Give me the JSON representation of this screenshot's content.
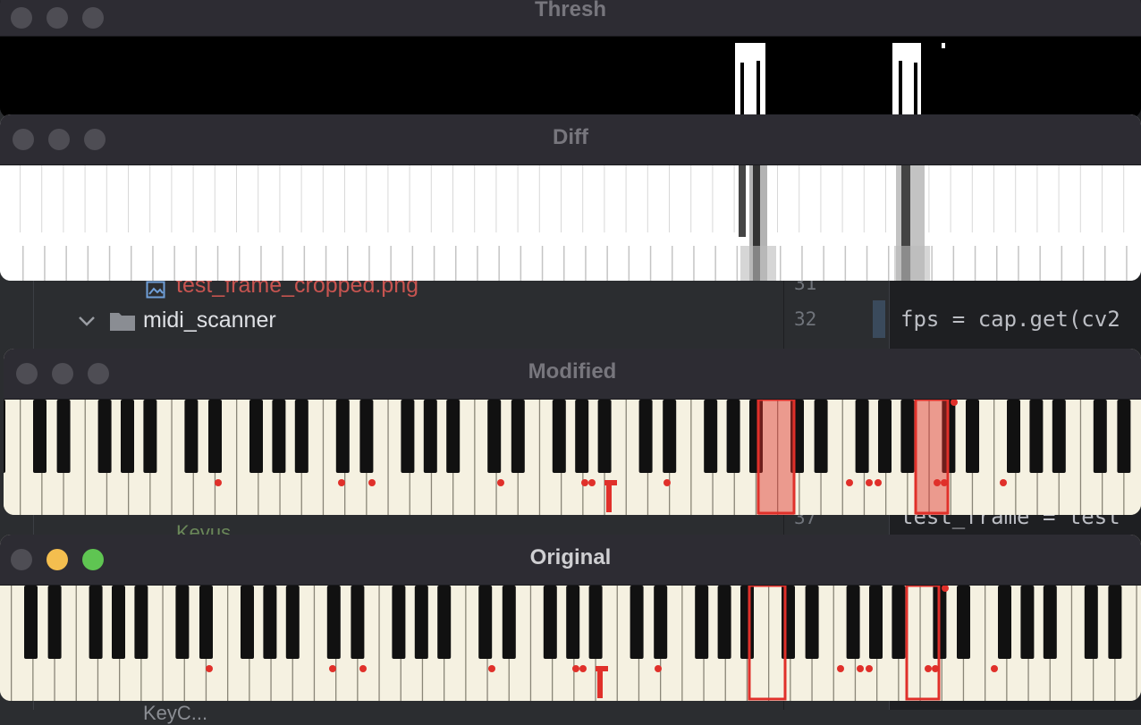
{
  "ide": {
    "tree": {
      "file_cropped": "test_frame_cropped.png",
      "folder": "midi_scanner",
      "partial_bottom_1": "Kevus",
      "partial_bottom_2": "KeyC..."
    },
    "editor": {
      "lines": [
        {
          "no": "31",
          "code": ""
        },
        {
          "no": "32",
          "code": "fps = cap.get(cv2"
        },
        {
          "no": "37",
          "code": "test_frame = test"
        }
      ]
    }
  },
  "windows": {
    "thresh": {
      "title": "Thresh"
    },
    "diff": {
      "title": "Diff"
    },
    "modified": {
      "title": "Modified"
    },
    "original": {
      "title": "Original"
    }
  },
  "colors": {
    "titlebar": "#2d2c33",
    "highlight_red": "#e0302a",
    "ivory": "#f5f1e1",
    "traffic_yellow": "#f4be4f",
    "traffic_green": "#5fc552"
  },
  "icons": {
    "image_file": "image-file-icon",
    "folder": "folder-icon",
    "chevron": "chevron-down-icon"
  }
}
